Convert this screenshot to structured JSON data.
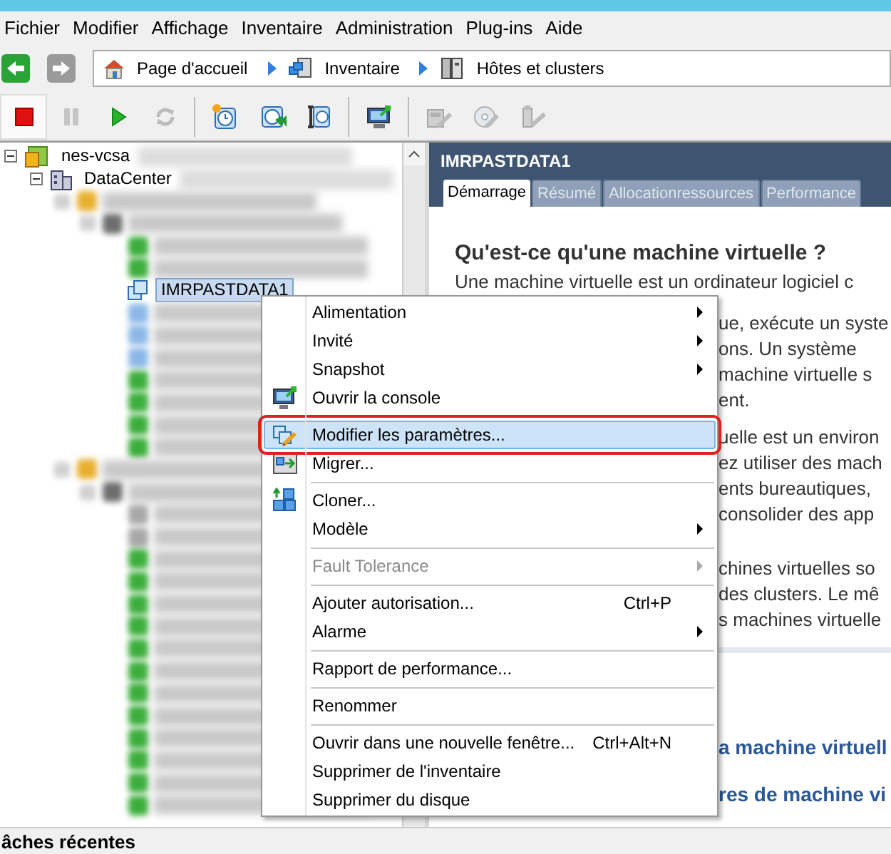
{
  "menu_bar": [
    "Fichier",
    "Modifier",
    "Affichage",
    "Inventaire",
    "Administration",
    "Plug-ins",
    "Aide"
  ],
  "navigation": {
    "back_disabled": false,
    "forward_disabled": true,
    "breadcrumb": [
      {
        "kind": "home",
        "label": "Page d'accueil"
      },
      {
        "kind": "inventory",
        "label": "Inventaire"
      },
      {
        "kind": "hosts",
        "label": "Hôtes et clusters"
      }
    ]
  },
  "toolbar": [
    [
      {
        "kind": "stop",
        "disabled": false,
        "selected": true
      },
      {
        "kind": "pause",
        "disabled": true,
        "selected": false
      },
      {
        "kind": "play",
        "disabled": false,
        "selected": false
      },
      {
        "kind": "reset",
        "disabled": true,
        "selected": false
      }
    ],
    [
      {
        "kind": "snapshot-take",
        "disabled": false,
        "selected": false
      },
      {
        "kind": "snapshot-revert",
        "disabled": false,
        "selected": false
      },
      {
        "kind": "snapshot-manager",
        "disabled": false,
        "selected": false
      }
    ],
    [
      {
        "kind": "console",
        "disabled": false,
        "selected": false
      }
    ],
    [
      {
        "kind": "edit",
        "disabled": true,
        "selected": false
      },
      {
        "kind": "disc",
        "disabled": true,
        "selected": false
      },
      {
        "kind": "usb",
        "disabled": true,
        "selected": false
      }
    ]
  ],
  "tree": [
    {
      "kind": "vcenter",
      "label": "nes-vcsa",
      "redacted": true,
      "expanded": true,
      "selected": false,
      "children": [
        {
          "kind": "datacenter",
          "label": "DataCenter",
          "redacted": true,
          "expanded": true,
          "selected": false,
          "children": [
            {
              "kind": "folder",
              "redacted": true,
              "expanded": true,
              "selected": false,
              "children": [
                {
                  "kind": "host",
                  "redacted": true,
                  "expanded": true,
                  "selected": false,
                  "children": [
                    {
                      "kind": "vm-on",
                      "redacted": true,
                      "selected": false
                    },
                    {
                      "kind": "vm-on",
                      "redacted": true,
                      "selected": false
                    },
                    {
                      "kind": "vm-template",
                      "label": "IMRPASTDATA1",
                      "redacted": false,
                      "selected": true
                    },
                    {
                      "kind": "vm-template",
                      "redacted": true,
                      "selected": false
                    },
                    {
                      "kind": "vm-template",
                      "redacted": true,
                      "selected": false
                    },
                    {
                      "kind": "vm-template",
                      "redacted": true,
                      "selected": false
                    },
                    {
                      "kind": "vm-on",
                      "redacted": true,
                      "selected": false
                    },
                    {
                      "kind": "vm-on",
                      "redacted": true,
                      "selected": false
                    },
                    {
                      "kind": "vm-on",
                      "redacted": true,
                      "selected": false
                    },
                    {
                      "kind": "vm-on",
                      "redacted": true,
                      "selected": false
                    }
                  ]
                }
              ]
            },
            {
              "kind": "folder",
              "redacted": true,
              "expanded": true,
              "selected": false,
              "children": [
                {
                  "kind": "host",
                  "redacted": true,
                  "expanded": true,
                  "selected": false,
                  "children": [
                    {
                      "kind": "vm-off",
                      "redacted": true,
                      "selected": false
                    },
                    {
                      "kind": "vm-off",
                      "redacted": true,
                      "selected": false
                    },
                    {
                      "kind": "vm-on",
                      "redacted": true,
                      "selected": false
                    },
                    {
                      "kind": "vm-on",
                      "redacted": true,
                      "selected": false
                    },
                    {
                      "kind": "vm-on",
                      "redacted": true,
                      "selected": false
                    },
                    {
                      "kind": "vm-on",
                      "redacted": true,
                      "selected": false
                    },
                    {
                      "kind": "vm-on",
                      "redacted": true,
                      "selected": false
                    },
                    {
                      "kind": "vm-on",
                      "redacted": true,
                      "selected": false
                    },
                    {
                      "kind": "vm-on",
                      "redacted": true,
                      "selected": false
                    },
                    {
                      "kind": "vm-on",
                      "redacted": true,
                      "selected": false
                    },
                    {
                      "kind": "vm-on",
                      "redacted": true,
                      "selected": false
                    },
                    {
                      "kind": "vm-on",
                      "redacted": true,
                      "selected": false
                    },
                    {
                      "kind": "vm-on",
                      "redacted": true,
                      "selected": false
                    },
                    {
                      "kind": "vm-on",
                      "redacted": true,
                      "selected": false
                    }
                  ]
                }
              ]
            }
          ]
        }
      ]
    }
  ],
  "panel": {
    "title": "IMRPASTDATA1",
    "tabs": [
      {
        "label": "Démarrage",
        "selected": true
      },
      {
        "label": "Résumé",
        "selected": false
      },
      {
        "label": "Allocationressources",
        "selected": false
      },
      {
        "label": "Performance",
        "selected": false
      }
    ],
    "heading": "Qu'est-ce qu'une machine virtuelle ?",
    "lead": "Une machine virtuelle est un ordinateur logiciel c",
    "paragraphs": [
      [
        "ue, exécute un syste",
        "ons. Un système",
        "machine virtuelle s",
        "ent."
      ],
      [
        "uelle est un environ",
        "ez utiliser des mach",
        "ents bureautiques,",
        "consolider des app"
      ],
      [
        "chines virtuelles so",
        "des clusters. Le mê",
        "s machines virtuelle"
      ]
    ],
    "links": [
      "a machine virtuell",
      "res de machine vi"
    ]
  },
  "context_menu": [
    [
      {
        "kind": "plain",
        "label": "Alimentation",
        "submenu": true,
        "disabled": false,
        "selected": false
      },
      {
        "kind": "plain",
        "label": "Invité",
        "submenu": true,
        "disabled": false,
        "selected": false
      },
      {
        "kind": "plain",
        "label": "Snapshot",
        "submenu": true,
        "disabled": false,
        "selected": false
      },
      {
        "kind": "console",
        "label": "Ouvrir la console",
        "submenu": false,
        "disabled": false,
        "selected": false
      }
    ],
    [
      {
        "kind": "edit",
        "label": "Modifier les paramètres...",
        "submenu": false,
        "disabled": false,
        "selected": true,
        "annotated": true
      },
      {
        "kind": "migrate",
        "label": "Migrer...",
        "submenu": false,
        "disabled": false,
        "selected": false
      }
    ],
    [
      {
        "kind": "clone",
        "label": "Cloner...",
        "submenu": false,
        "disabled": false,
        "selected": false
      },
      {
        "kind": "plain",
        "label": "Modèle",
        "submenu": true,
        "disabled": false,
        "selected": false
      }
    ],
    [
      {
        "kind": "plain",
        "label": "Fault Tolerance",
        "submenu": true,
        "disabled": true,
        "selected": false
      }
    ],
    [
      {
        "kind": "plain",
        "label": "Ajouter autorisation...",
        "shortcut": "Ctrl+P",
        "submenu": false,
        "disabled": false,
        "selected": false
      },
      {
        "kind": "plain",
        "label": "Alarme",
        "submenu": true,
        "disabled": false,
        "selected": false
      }
    ],
    [
      {
        "kind": "plain",
        "label": "Rapport de performance...",
        "submenu": false,
        "disabled": false,
        "selected": false
      }
    ],
    [
      {
        "kind": "plain",
        "label": "Renommer",
        "submenu": false,
        "disabled": false,
        "selected": false
      }
    ],
    [
      {
        "kind": "plain",
        "label": "Ouvrir dans une nouvelle fenêtre...",
        "shortcut": "Ctrl+Alt+N",
        "submenu": false,
        "disabled": false,
        "selected": false
      },
      {
        "kind": "plain",
        "label": "Supprimer de l'inventaire",
        "submenu": false,
        "disabled": false,
        "selected": false
      },
      {
        "kind": "plain",
        "label": "Supprimer du disque",
        "submenu": false,
        "disabled": false,
        "selected": false
      }
    ]
  ],
  "status_bar": {
    "label": "âches récentes"
  }
}
